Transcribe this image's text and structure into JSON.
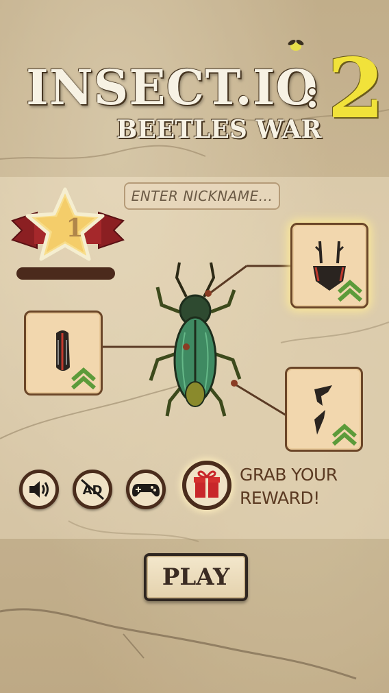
{
  "title": {
    "main": "INSECT.IO",
    "number": "2",
    "subtitle": "BEETLES WAR"
  },
  "nickname": {
    "placeholder": "ENTER NICKNAME..."
  },
  "rank": {
    "level": "1",
    "xp_progress": 0
  },
  "parts": {
    "horns": {
      "icon": "antler-horns-icon",
      "upgrade_icon": "upgrade-chevrons-icon"
    },
    "shell": {
      "icon": "wing-shell-icon",
      "upgrade_icon": "upgrade-chevrons-icon"
    },
    "claws": {
      "icon": "claws-icon",
      "upgrade_icon": "upgrade-chevrons-icon"
    }
  },
  "buttons": {
    "sound_icon": "speaker-icon",
    "no_ads_icon": "no-ads-icon",
    "ad_text": "AD",
    "gamepad_icon": "gamepad-icon",
    "gift_icon": "gift-icon",
    "reward_line1": "GRAB YOUR",
    "reward_line2": "REWARD!",
    "play": "PLAY"
  },
  "colors": {
    "accent_yellow": "#f1e23a",
    "upgrade_green": "#5c9b3a",
    "frame_brown": "#6b4628",
    "ribbon_red": "#8b1f22"
  }
}
